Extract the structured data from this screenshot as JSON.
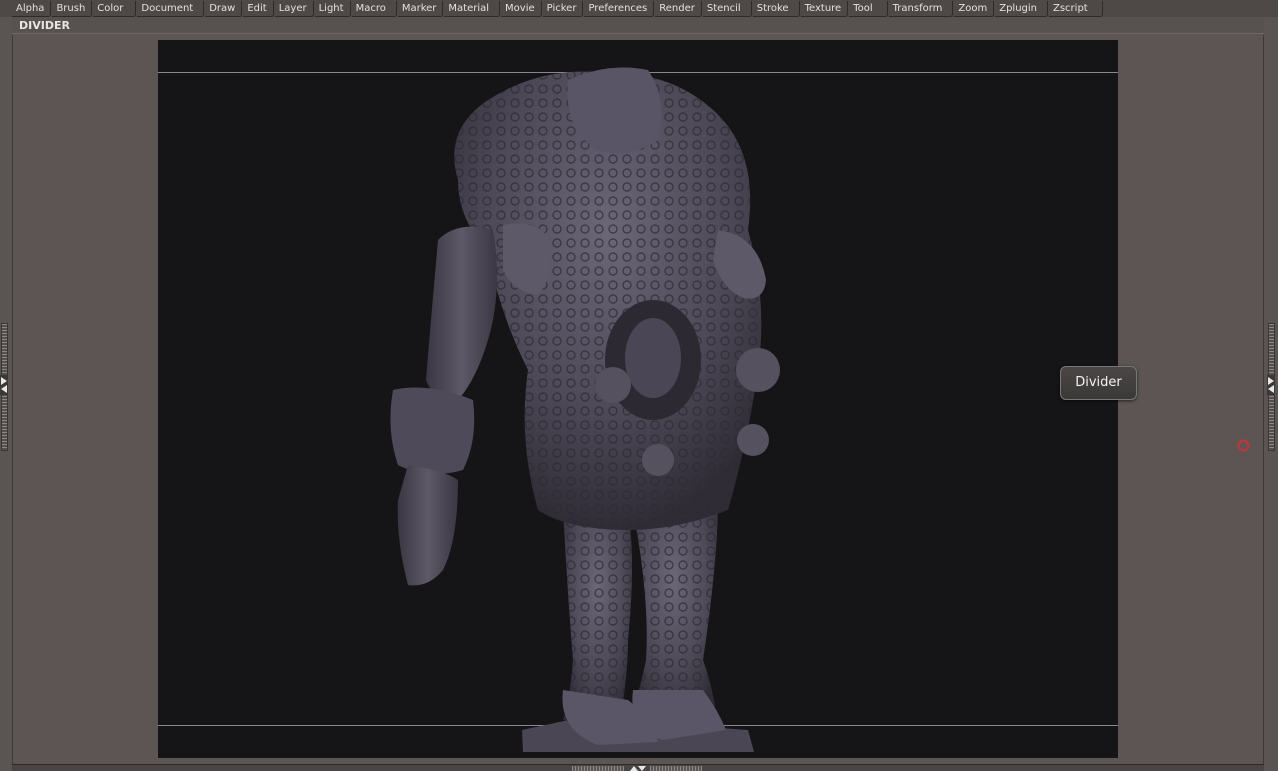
{
  "menubar": {
    "items": [
      "Alpha",
      "Brush",
      "Color",
      "Document",
      "Draw",
      "Edit",
      "Layer",
      "Light",
      "Macro",
      "Marker",
      "Material",
      "Movie",
      "Picker",
      "Preferences",
      "Render",
      "Stencil",
      "Stroke",
      "Texture",
      "Tool",
      "Transform",
      "Zoom",
      "Zplugin",
      "Zscript"
    ]
  },
  "palette": {
    "title": "DIVIDER"
  },
  "tooltip": {
    "text": "Divider"
  },
  "colors": {
    "background": "#5a5452",
    "canvas": "#151518",
    "model": "#5a5566",
    "marker": "#b53a3a"
  },
  "icons": {
    "left_arrow": "triangle-right-left",
    "right_arrow": "triangle-right-left",
    "marker": "red-circle-marker"
  }
}
